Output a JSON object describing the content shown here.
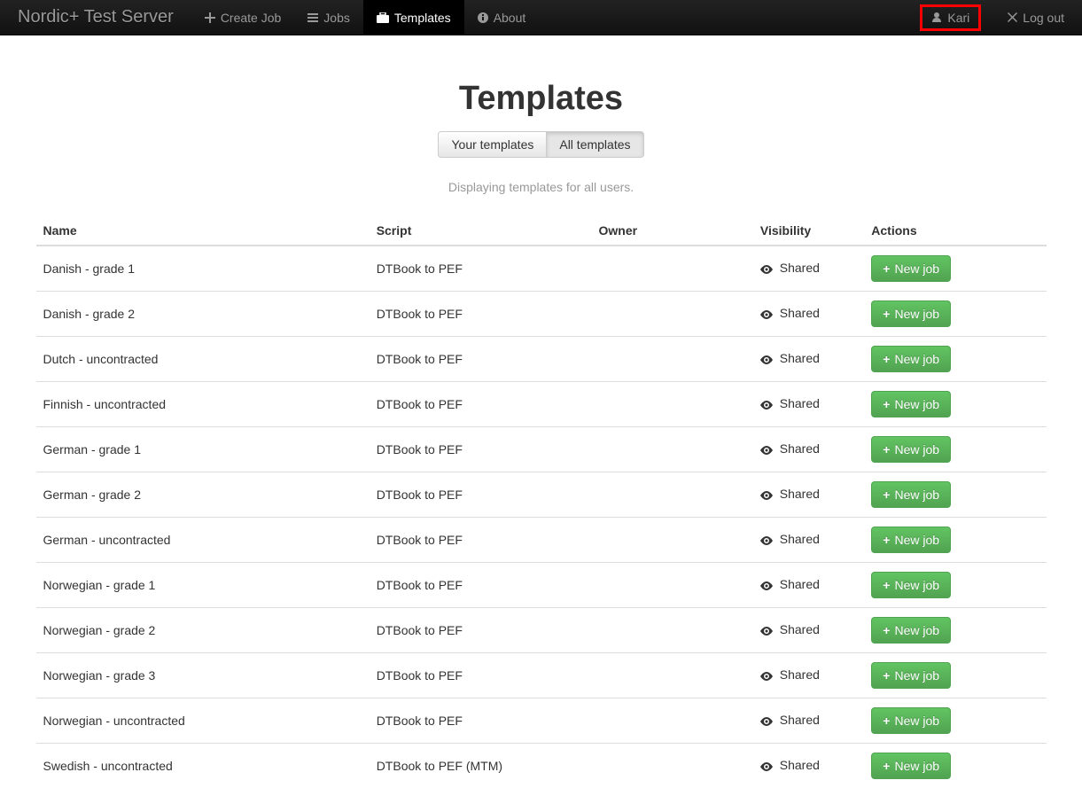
{
  "navbar": {
    "brand": "Nordic+ Test Server",
    "items": [
      {
        "label": "Create Job",
        "icon": "plus"
      },
      {
        "label": "Jobs",
        "icon": "list"
      },
      {
        "label": "Templates",
        "icon": "briefcase",
        "active": true
      },
      {
        "label": "About",
        "icon": "info"
      }
    ],
    "user": "Kari",
    "logout": "Log out"
  },
  "page": {
    "title": "Templates",
    "tabs": {
      "your": "Your templates",
      "all": "All templates"
    },
    "subtext": "Displaying templates for all users."
  },
  "table": {
    "headers": {
      "name": "Name",
      "script": "Script",
      "owner": "Owner",
      "visibility": "Visibility",
      "actions": "Actions"
    },
    "new_job_label": "New job",
    "rows": [
      {
        "name": "Danish - grade 1",
        "script": "DTBook to PEF",
        "owner": "",
        "visibility": "Shared"
      },
      {
        "name": "Danish - grade 2",
        "script": "DTBook to PEF",
        "owner": "",
        "visibility": "Shared"
      },
      {
        "name": "Dutch - uncontracted",
        "script": "DTBook to PEF",
        "owner": "",
        "visibility": "Shared"
      },
      {
        "name": "Finnish - uncontracted",
        "script": "DTBook to PEF",
        "owner": "",
        "visibility": "Shared"
      },
      {
        "name": "German - grade 1",
        "script": "DTBook to PEF",
        "owner": "",
        "visibility": "Shared"
      },
      {
        "name": "German - grade 2",
        "script": "DTBook to PEF",
        "owner": "",
        "visibility": "Shared"
      },
      {
        "name": "German - uncontracted",
        "script": "DTBook to PEF",
        "owner": "",
        "visibility": "Shared"
      },
      {
        "name": "Norwegian - grade 1",
        "script": "DTBook to PEF",
        "owner": "",
        "visibility": "Shared"
      },
      {
        "name": "Norwegian - grade 2",
        "script": "DTBook to PEF",
        "owner": "",
        "visibility": "Shared"
      },
      {
        "name": "Norwegian - grade 3",
        "script": "DTBook to PEF",
        "owner": "",
        "visibility": "Shared"
      },
      {
        "name": "Norwegian - uncontracted",
        "script": "DTBook to PEF",
        "owner": "",
        "visibility": "Shared"
      },
      {
        "name": "Swedish - uncontracted",
        "script": "DTBook to PEF (MTM)",
        "owner": "",
        "visibility": "Shared"
      }
    ]
  }
}
